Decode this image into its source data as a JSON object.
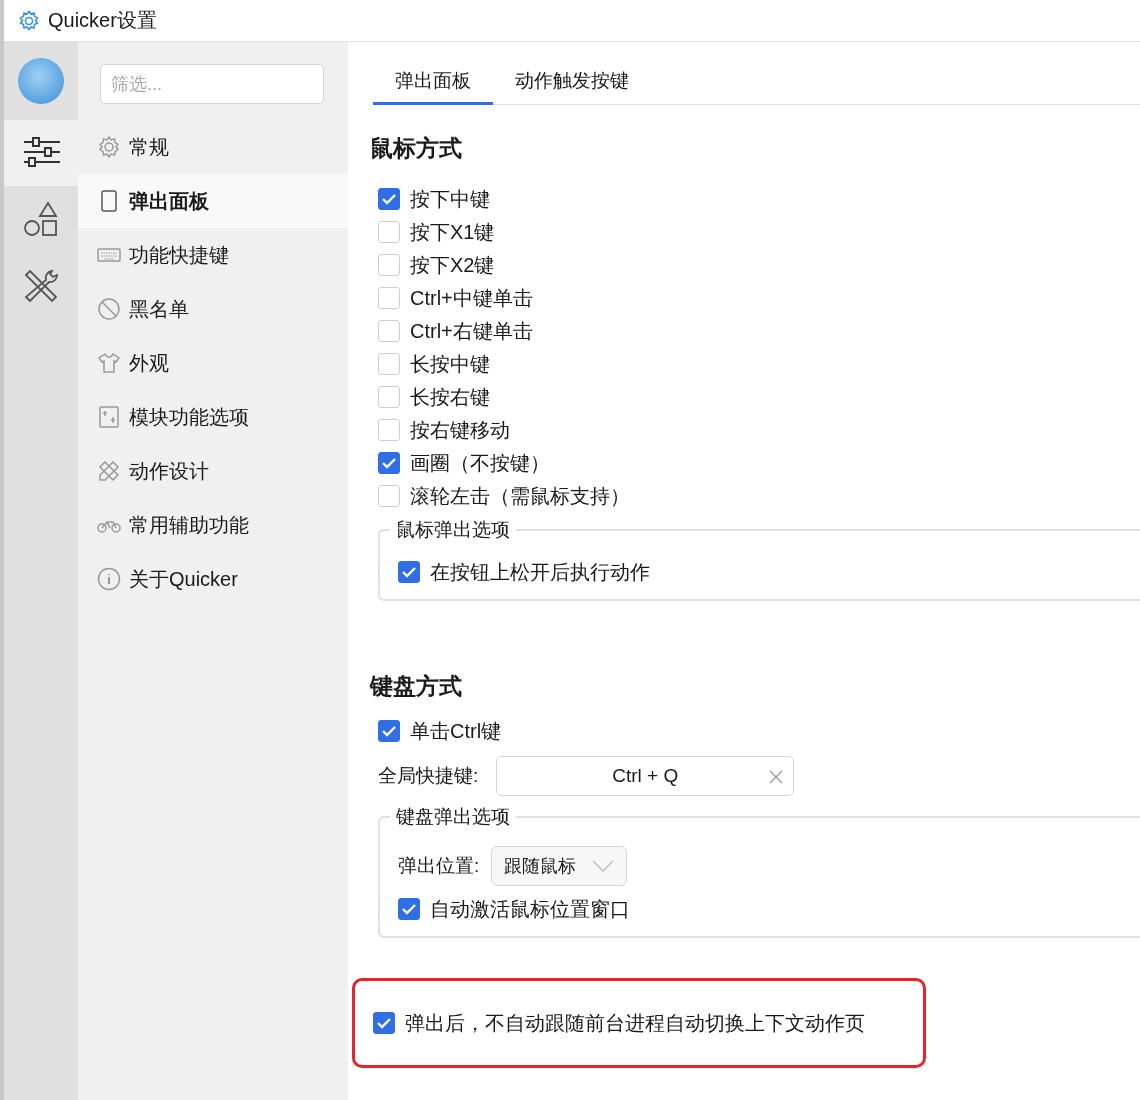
{
  "window": {
    "title": "Quicker设置"
  },
  "rail": {
    "items": [
      {
        "kind": "avatar",
        "selected": false
      },
      {
        "kind": "icon",
        "selected": true
      },
      {
        "kind": "icon",
        "selected": false
      },
      {
        "kind": "icon",
        "selected": false
      }
    ]
  },
  "nav": {
    "filter": {
      "placeholder": "筛选..."
    },
    "items": [
      {
        "label": "常规",
        "selected": false
      },
      {
        "label": "弹出面板",
        "selected": true
      },
      {
        "label": "功能快捷键",
        "selected": false
      },
      {
        "label": "黑名单",
        "selected": false
      },
      {
        "label": "外观",
        "selected": false
      },
      {
        "label": "模块功能选项",
        "selected": false
      },
      {
        "label": "动作设计",
        "selected": false
      },
      {
        "label": "常用辅助功能",
        "selected": false
      },
      {
        "label": "关于Quicker",
        "selected": false
      }
    ]
  },
  "tabs": [
    {
      "label": "弹出面板",
      "selected": true
    },
    {
      "label": "动作触发按键",
      "selected": false
    }
  ],
  "mouse": {
    "heading": "鼠标方式",
    "options": [
      {
        "label": "按下中键",
        "checked": true
      },
      {
        "label": "按下X1键",
        "checked": false
      },
      {
        "label": "按下X2键",
        "checked": false
      },
      {
        "label": "Ctrl+中键单击",
        "checked": false
      },
      {
        "label": "Ctrl+右键单击",
        "checked": false
      },
      {
        "label": "长按中键",
        "checked": false
      },
      {
        "label": "长按右键",
        "checked": false
      },
      {
        "label": "按右键移动",
        "checked": false
      },
      {
        "label": "画圈（不按键）",
        "checked": true
      },
      {
        "label": "滚轮左击（需鼠标支持）",
        "checked": false
      }
    ],
    "group": {
      "title": "鼠标弹出选项",
      "options": [
        {
          "label": "在按钮上松开后执行动作",
          "checked": true
        }
      ]
    }
  },
  "keyboard": {
    "heading": "键盘方式",
    "options": [
      {
        "label": "单击Ctrl键",
        "checked": true
      }
    ],
    "hotkey": {
      "label": "全局快捷键:",
      "value": "Ctrl + Q"
    },
    "group": {
      "title": "键盘弹出选项",
      "position": {
        "label": "弹出位置:",
        "value": "跟随鼠标"
      },
      "options": [
        {
          "label": "自动激活鼠标位置窗口",
          "checked": true
        }
      ]
    }
  },
  "bottom_option": {
    "label": "弹出后，不自动跟随前台进程自动切换上下文动作页",
    "checked": true,
    "highlighted": true
  }
}
